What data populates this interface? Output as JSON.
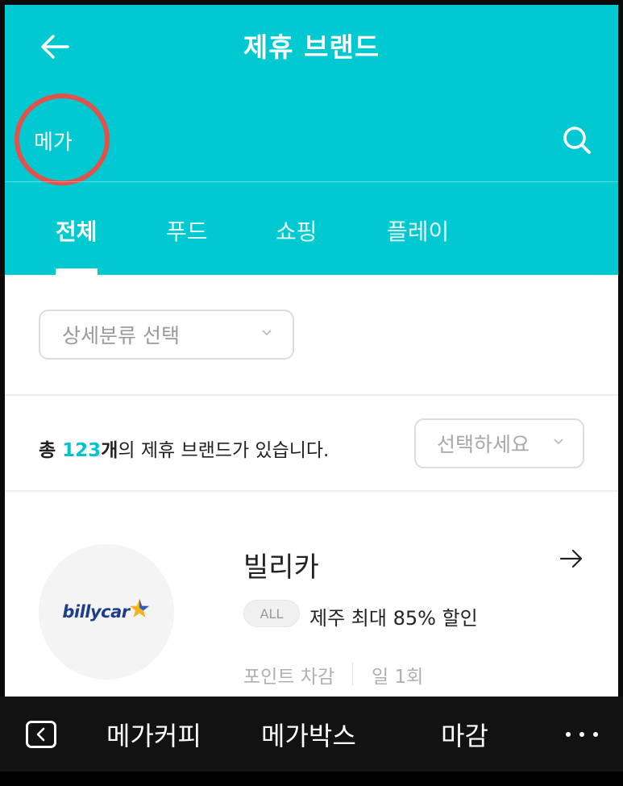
{
  "header": {
    "title": "제휴 브랜드",
    "back_icon": "arrow-left-icon",
    "search_value": "메가",
    "search_icon": "search-icon",
    "accent_color": "#00c9d2"
  },
  "tabs": [
    {
      "label": "전체",
      "active": true
    },
    {
      "label": "푸드",
      "active": false
    },
    {
      "label": "쇼핑",
      "active": false
    },
    {
      "label": "플레이",
      "active": false
    }
  ],
  "filter": {
    "category_placeholder": "상세분류 선택",
    "sort_placeholder": "선택하세요",
    "chevron_icon": "chevron-down-icon"
  },
  "summary": {
    "prefix": "총 ",
    "count": "123",
    "unit": "개",
    "suffix": "의 제휴 브랜드가 있습니다."
  },
  "brands": [
    {
      "name": "빌리카",
      "logo_text": "billycar",
      "badge": "ALL",
      "benefit": "제주 최대 85% 할인",
      "usage_type": "포인트 차감",
      "limit": "일 1회",
      "arrow_icon": "arrow-right-icon"
    }
  ],
  "keyboard_suggestions": {
    "items": [
      "메가커피",
      "메가박스",
      "마감"
    ],
    "back_icon": "keyboard-back-icon",
    "more_icon": "more-horizontal-icon"
  }
}
